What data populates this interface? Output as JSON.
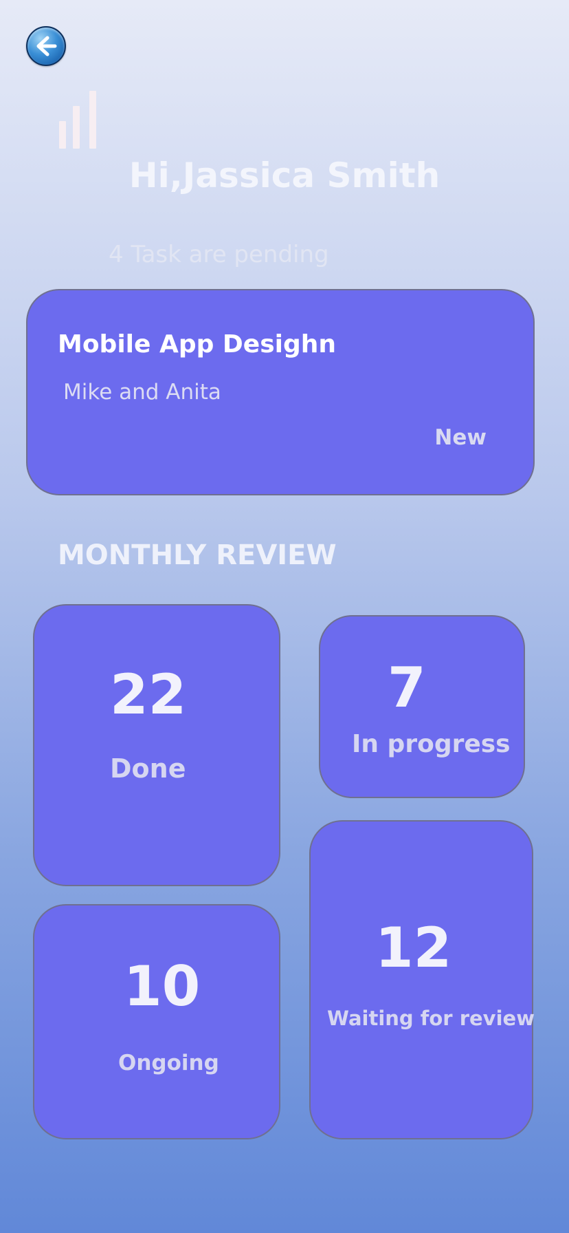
{
  "header": {
    "greeting": "Hi,Jassica Smith",
    "subtitle": "4 Task are pending"
  },
  "task_card": {
    "title": "Mobile App Desighn",
    "members": "Mike and Anita",
    "status": "New"
  },
  "monthly_review": {
    "heading": "MONTHLY REVIEW",
    "done": {
      "value": "22",
      "label": "Done"
    },
    "in_progress": {
      "value": "7",
      "label": "In progress"
    },
    "ongoing": {
      "value": "10",
      "label": "Ongoing"
    },
    "waiting": {
      "value": "12",
      "label": "Waiting for review"
    }
  },
  "icons": {
    "back": "arrow-left-icon",
    "signal": "signal-bars-icon"
  },
  "colors": {
    "card": "#6c6bee",
    "background_top": "#e6eaf7",
    "background_bottom": "#6188d8"
  }
}
